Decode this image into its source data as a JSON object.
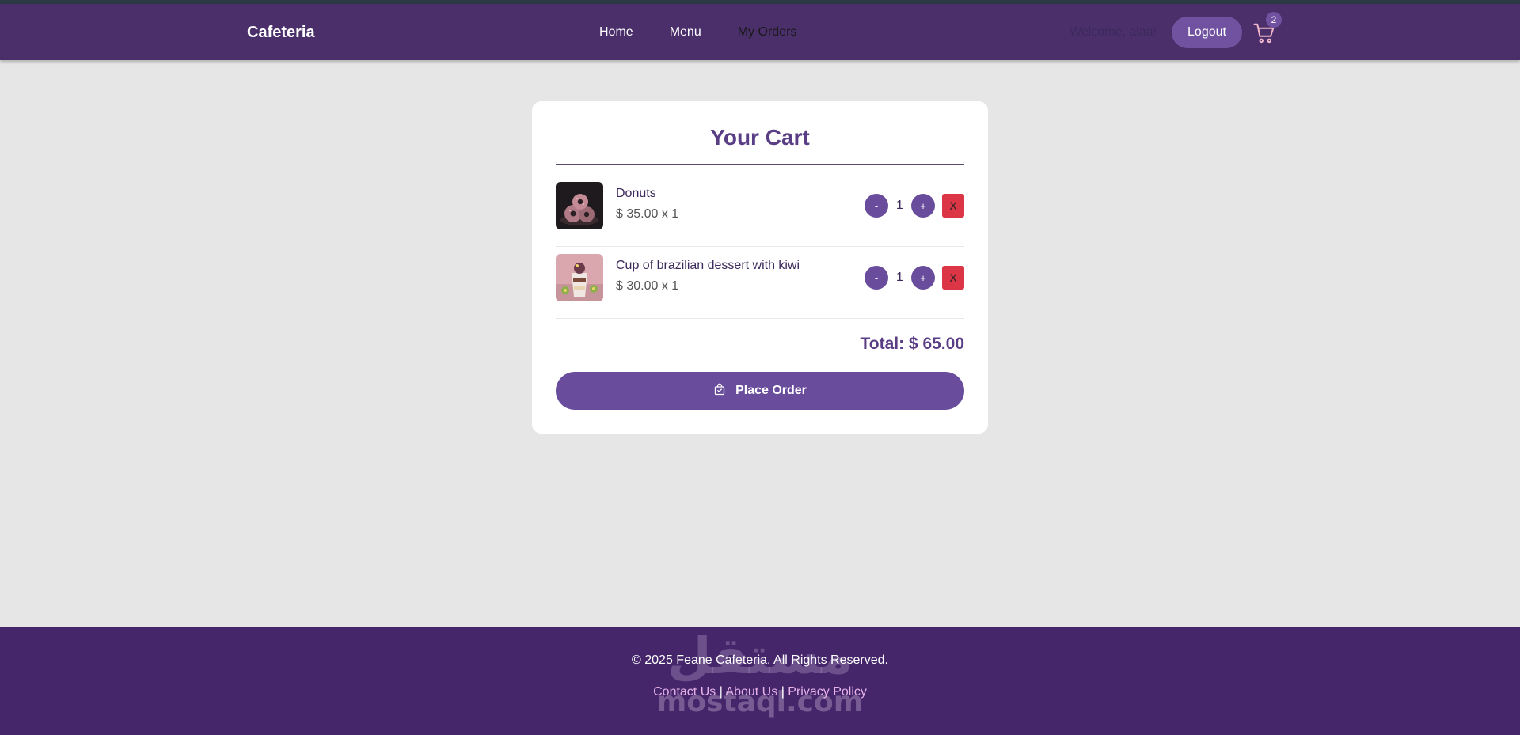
{
  "navbar": {
    "brand": "Cafeteria",
    "links": [
      "Home",
      "Menu",
      "My Orders"
    ],
    "welcome": "Welcome, alaa!",
    "logout_label": "Logout",
    "cart_count": "2",
    "cart_icon": "cart-icon"
  },
  "cart": {
    "title": "Your Cart",
    "items": [
      {
        "name": "Donuts",
        "price_line": "$ 35.00 x 1",
        "quantity": "1",
        "minus": "-",
        "plus": "+",
        "remove": "X"
      },
      {
        "name": "Cup of brazilian dessert with kiwi",
        "price_line": "$ 30.00 x 1",
        "quantity": "1",
        "minus": "-",
        "plus": "+",
        "remove": "X"
      }
    ],
    "total": "Total: $ 65.00",
    "place_order_label": "Place Order",
    "place_order_icon": "shopping-bag-check-icon"
  },
  "footer": {
    "copyright": "© 2025 Feane Cafeteria. All Rights Reserved.",
    "links": [
      "Contact Us",
      "About Us",
      "Privacy Policy"
    ],
    "separator": "|",
    "watermark_arabic": "مستقل",
    "watermark_latin": "mostaql.com"
  },
  "colors": {
    "navbar": "#4a2f6b",
    "accent": "#6a4c9c",
    "danger": "#dc3545",
    "footer": "#45266b",
    "background": "#e6e6e6"
  }
}
